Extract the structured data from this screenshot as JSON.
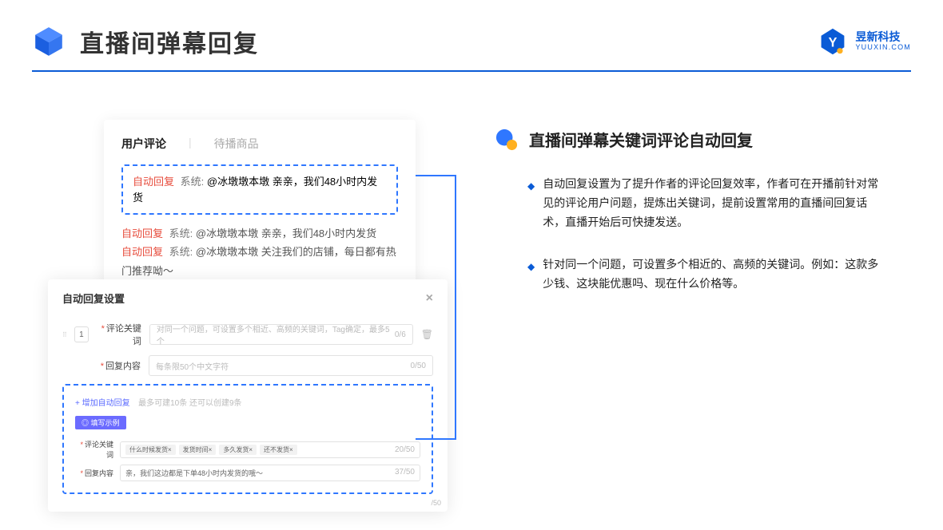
{
  "header": {
    "title": "直播间弹幕回复",
    "brand_cn": "昱新科技",
    "brand_en": "YUUXIN.COM"
  },
  "mockup1": {
    "tab_active": "用户评论",
    "tab_inactive": "待播商品",
    "hl_prefix": "自动回复",
    "hl_mid": "系统:",
    "hl_text": "@冰墩墩本墩 亲亲，我们48小时内发货",
    "line2_prefix": "自动回复",
    "line2_mid": "系统:",
    "line2_text": "@冰墩墩本墩 亲亲，我们48小时内发货",
    "line3_prefix": "自动回复",
    "line3_mid": "系统:",
    "line3_text": "@冰墩墩本墩 关注我们的店铺，每日都有热门推荐呦～"
  },
  "mockup2": {
    "modal_title": "自动回复设置",
    "idx": "1",
    "row1_label": "评论关键词",
    "row1_placeholder": "对同一个问题，可设置多个相近、高频的关键词，Tag确定，最多5个",
    "row1_counter": "0/6",
    "row2_label": "回复内容",
    "row2_placeholder": "每条限50个中文字符",
    "row2_counter": "0/50",
    "add_link": "+ 增加自动回复",
    "add_hint": "最多可建10条 还可以创建9条",
    "example_tag": "◎ 填写示例",
    "ex_row1_label": "评论关键词",
    "chip1": "什么时候发货×",
    "chip2": "发货时间×",
    "chip3": "多久发货×",
    "chip4": "还不发货×",
    "ex_row1_counter": "20/50",
    "ex_row2_label": "回复内容",
    "ex_row2_text": "亲，我们这边都是下单48小时内发货的哦～",
    "ex_row2_counter": "37/50",
    "scroll_counter": "/50"
  },
  "right": {
    "section_title": "直播间弹幕关键词评论自动回复",
    "bullet1": "自动回复设置为了提升作者的评论回复效率，作者可在开播前针对常见的评论用户问题，提炼出关键词，提前设置常用的直播间回复话术，直播开始后可快捷发送。",
    "bullet2": "针对同一个问题，可设置多个相近的、高频的关键词。例如：这款多少钱、这块能优惠吗、现在什么价格等。"
  }
}
